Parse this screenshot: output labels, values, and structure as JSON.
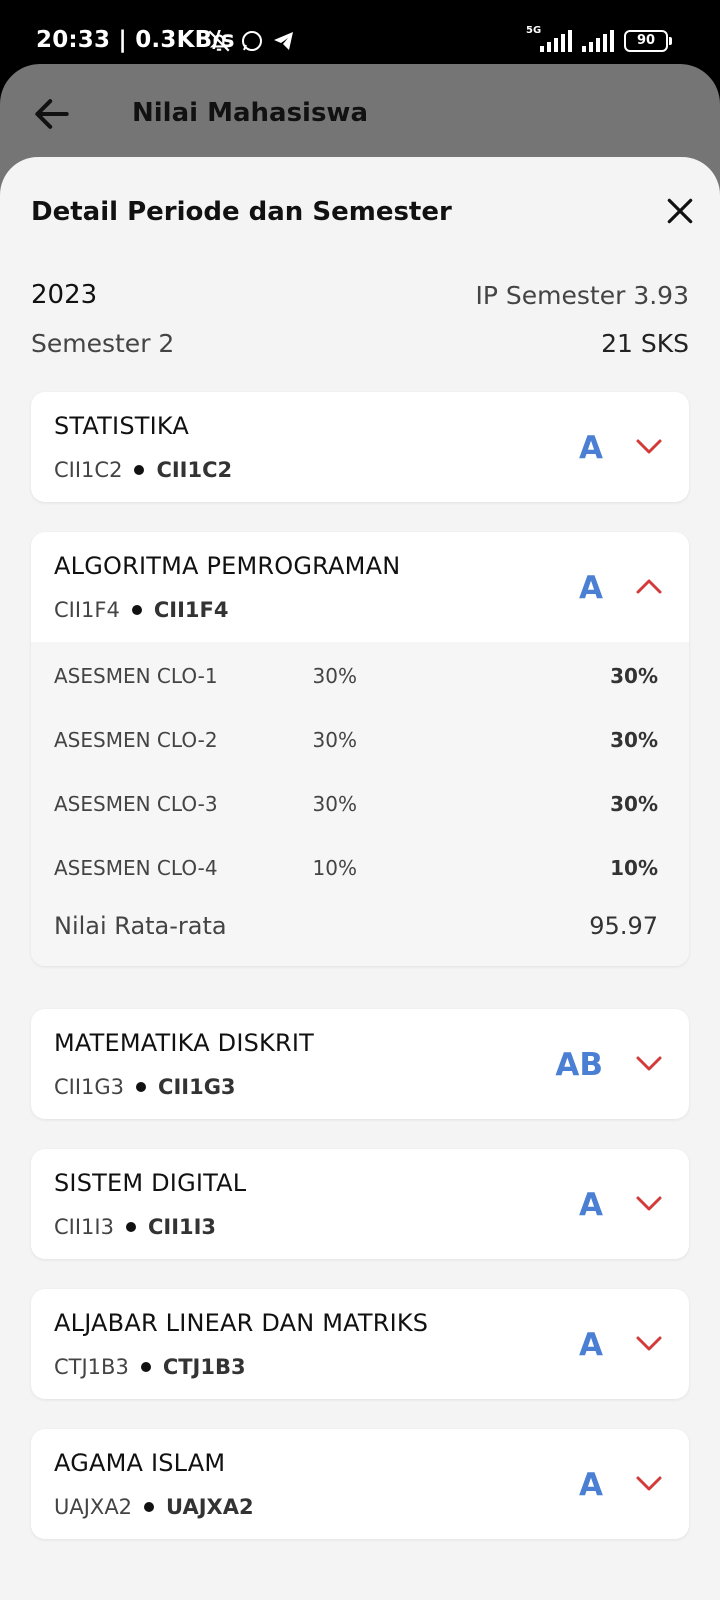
{
  "status_bar": {
    "time": "20:33 | 0.3KB/s",
    "network": "5G",
    "battery": "90"
  },
  "app_bar": {
    "title": "Nilai Mahasiswa"
  },
  "sheet": {
    "title": "Detail Periode dan Semester",
    "year": "2023",
    "ip_semester": "IP Semester 3.93",
    "semester": "Semester 2",
    "sks": "21 SKS"
  },
  "courses": [
    {
      "name": "STATISTIKA",
      "code1": "CII1C2",
      "code2": "CII1C2",
      "grade": "A",
      "expanded": false
    },
    {
      "name": "ALGORITMA PEMROGRAMAN",
      "code1": "CII1F4",
      "code2": "CII1F4",
      "grade": "A",
      "expanded": true,
      "assessments": [
        {
          "label": "ASESMEN CLO-1",
          "weight": "30%",
          "value": "30%"
        },
        {
          "label": "ASESMEN CLO-2",
          "weight": "30%",
          "value": "30%"
        },
        {
          "label": "ASESMEN CLO-3",
          "weight": "30%",
          "value": "30%"
        },
        {
          "label": "ASESMEN CLO-4",
          "weight": "10%",
          "value": "10%"
        }
      ],
      "average_label": "Nilai Rata-rata",
      "average_value": "95.97"
    },
    {
      "name": "MATEMATIKA DISKRIT",
      "code1": "CII1G3",
      "code2": "CII1G3",
      "grade": "AB",
      "expanded": false
    },
    {
      "name": "SISTEM DIGITAL",
      "code1": "CII1I3",
      "code2": "CII1I3",
      "grade": "A",
      "expanded": false
    },
    {
      "name": "ALJABAR LINEAR DAN MATRIKS",
      "code1": "CTJ1B3",
      "code2": "CTJ1B3",
      "grade": "A",
      "expanded": false
    },
    {
      "name": "AGAMA ISLAM",
      "code1": "UAJXA2",
      "code2": "UAJXA2",
      "grade": "A",
      "expanded": false
    }
  ],
  "colors": {
    "grade": "#4a7fd4",
    "chevron": "#d33a3a",
    "app_bar": "#757575",
    "sheet_bg": "#f4f4f4"
  }
}
